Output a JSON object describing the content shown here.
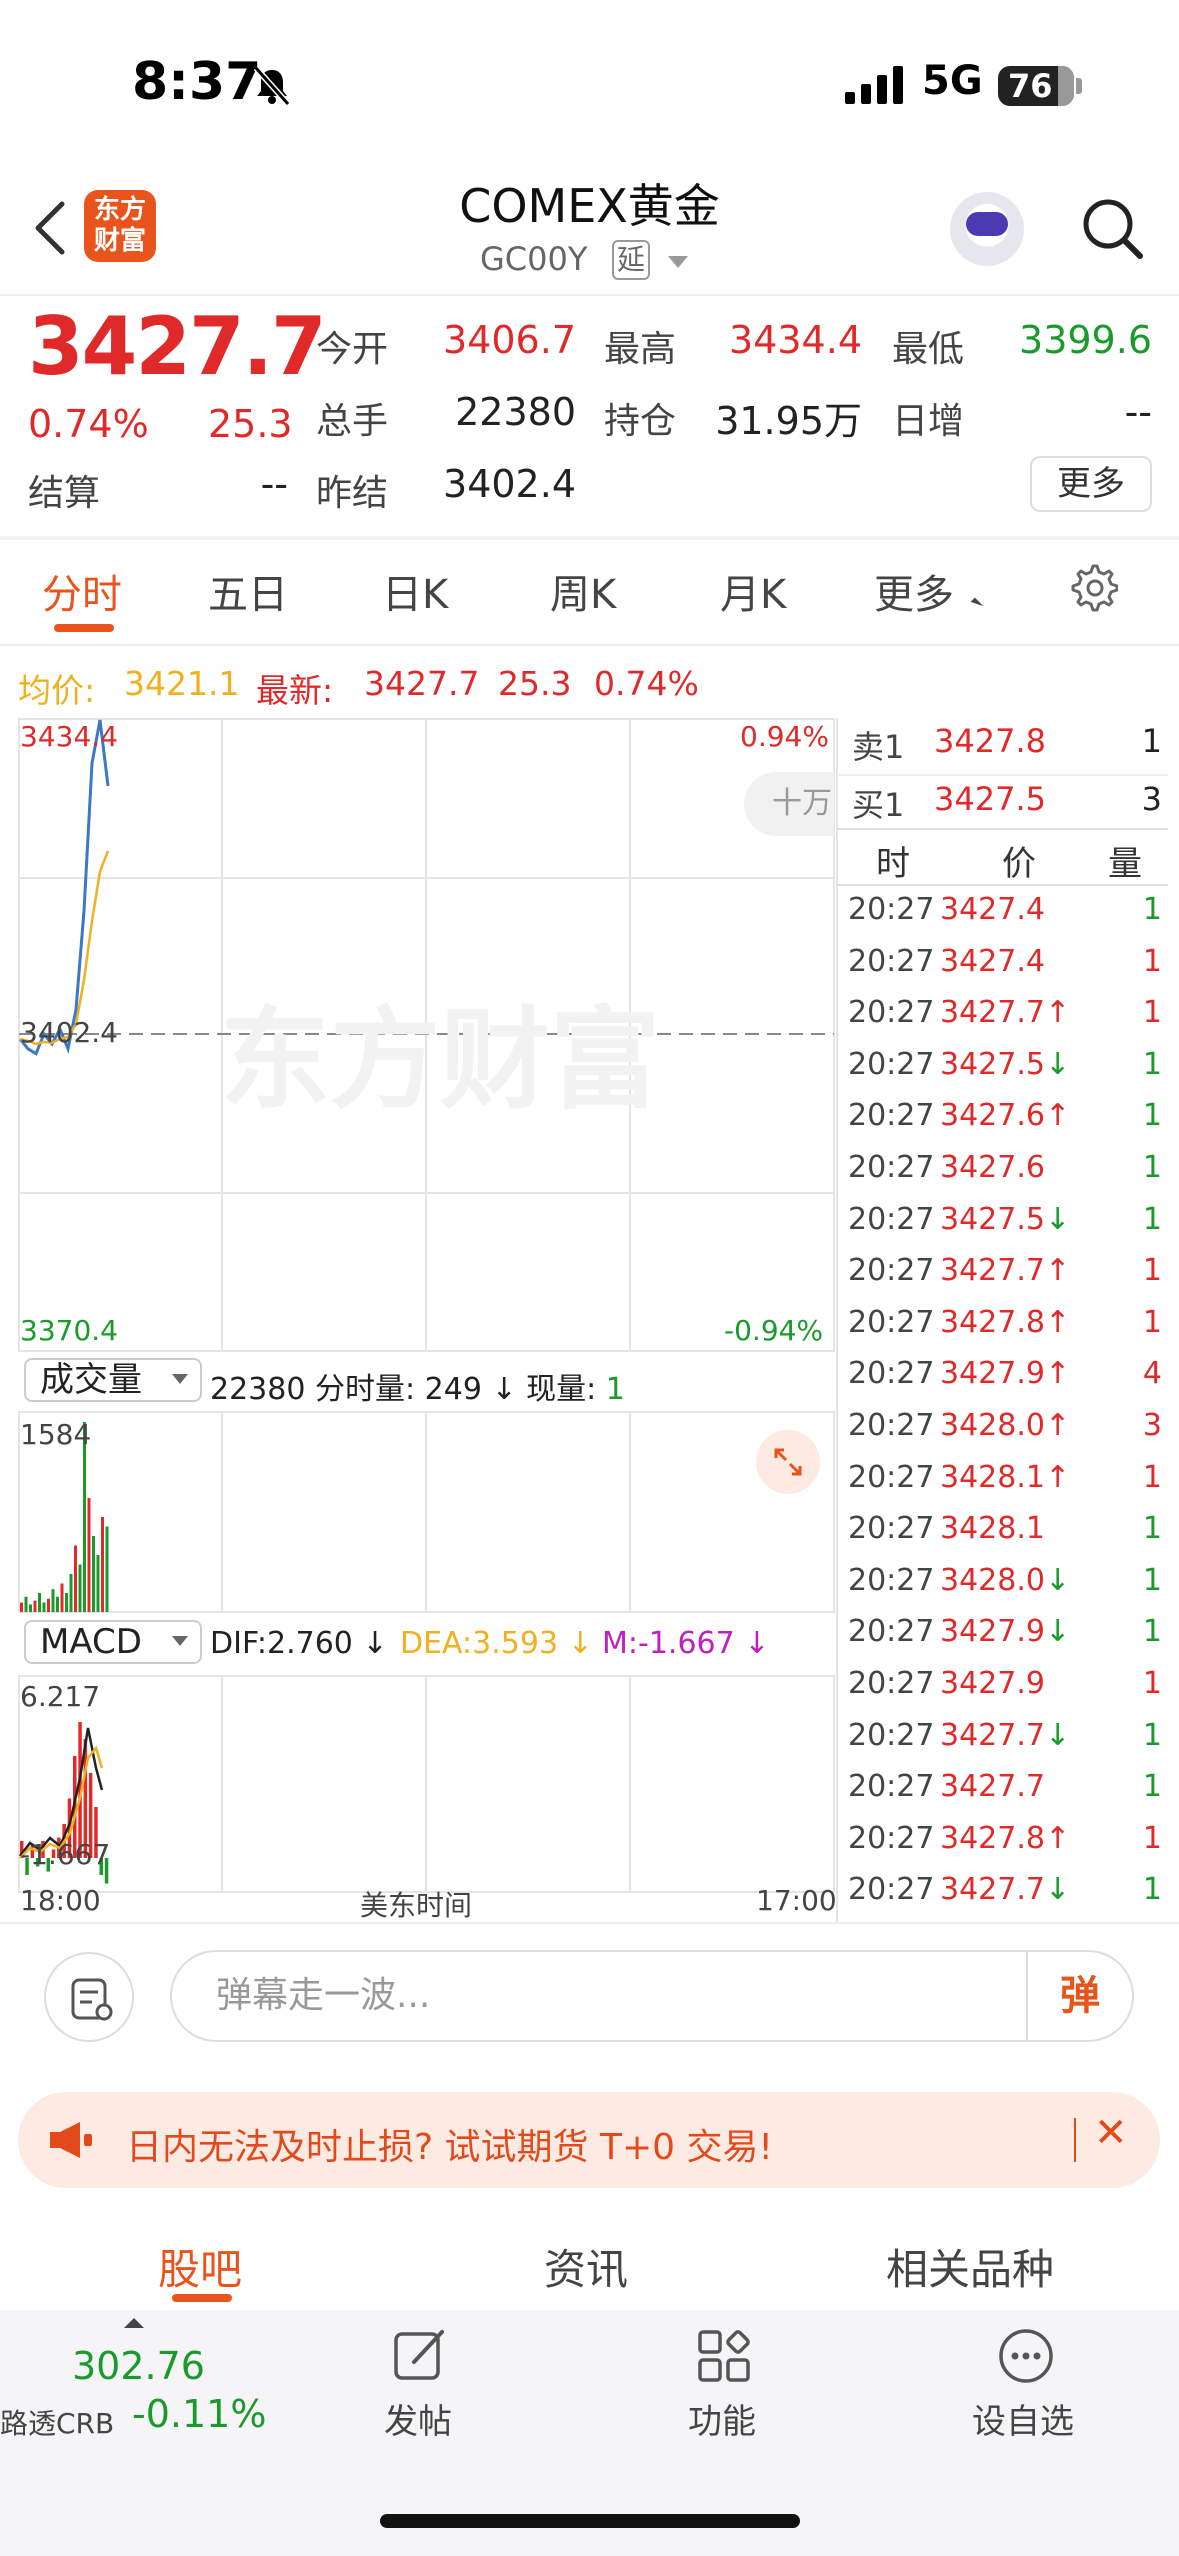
{
  "status": {
    "time": "8:37",
    "network": "5G",
    "battery": "76"
  },
  "header": {
    "logo_line1": "东方",
    "logo_line2": "财富",
    "title": "COMEX黄金",
    "code": "GC00Y",
    "tag": "延"
  },
  "quote": {
    "price": "3427.7",
    "pct": "0.74%",
    "change": "25.3",
    "open_label": "今开",
    "open": "3406.7",
    "high_label": "最高",
    "high": "3434.4",
    "low_label": "最低",
    "low": "3399.6",
    "volume_label": "总手",
    "volume": "22380",
    "oi_label": "持仓",
    "oi": "31.95万",
    "daily_inc_label": "日增",
    "daily_inc": "--",
    "settle_label": "结算",
    "settle": "--",
    "prev_settle_label": "昨结",
    "prev_settle": "3402.4",
    "more_label": "更多"
  },
  "tabs": [
    "分时",
    "五日",
    "日K",
    "周K",
    "月K",
    "更多"
  ],
  "info_line": {
    "avg_label": "均价:",
    "avg": "3421.1",
    "latest_label": "最新:",
    "latest": "3427.7",
    "change": "25.3",
    "pct": "0.74%"
  },
  "chart": {
    "y_top": "3434.4",
    "y_mid": "3402.4",
    "y_bottom": "3370.4",
    "pct_top": "0.94%",
    "pct_bottom": "-0.94%",
    "level2_tag": "十万",
    "watermark": "东方财富",
    "volume_select": "成交量",
    "volume_info_total": "22380",
    "volume_info_label": "分时量:",
    "volume_info_value": "249 ↓",
    "current_label": "现量:",
    "current_value": "1",
    "volume_max": "1584",
    "macd_select": "MACD",
    "dif": "DIF:2.760 ↓",
    "dea": "DEA:3.593 ↓",
    "m": "M:-1.667 ↓",
    "macd_top": "6.217",
    "macd_bottom": "-1.667",
    "x_start": "18:00",
    "x_mid": "美东时间",
    "x_end": "17:00"
  },
  "chart_data": {
    "type": "line",
    "x": [
      "18:00",
      "17:00"
    ],
    "series": [
      {
        "name": "最新",
        "values": [
          3402.0,
          3401.0,
          3400.5,
          3402.5,
          3401.5,
          3403.0,
          3401.0,
          3405.0,
          3415.0,
          3430.0,
          3434.4,
          3427.7
        ]
      },
      {
        "name": "均价",
        "values": [
          3402.0,
          3401.8,
          3401.5,
          3401.7,
          3401.6,
          3402.0,
          3402.2,
          3403.5,
          3408.0,
          3414.0,
          3419.0,
          3421.1
        ]
      }
    ],
    "ylim": [
      3370.4,
      3434.4
    ],
    "reference": 3402.4
  },
  "orderbook": {
    "sell_label": "卖1",
    "sell_price": "3427.8",
    "sell_qty": "1",
    "buy_label": "买1",
    "buy_price": "3427.5",
    "buy_qty": "3",
    "col_time": "时",
    "col_price": "价",
    "col_qty": "量"
  },
  "trades": [
    {
      "time": "20:27",
      "price": "3427.4",
      "dir": "",
      "qty": "1",
      "qcolor": "green"
    },
    {
      "time": "20:27",
      "price": "3427.4",
      "dir": "",
      "qty": "1",
      "qcolor": "red"
    },
    {
      "time": "20:27",
      "price": "3427.7",
      "dir": "↑",
      "qty": "1",
      "qcolor": "red"
    },
    {
      "time": "20:27",
      "price": "3427.5",
      "dir": "↓",
      "qty": "1",
      "qcolor": "green"
    },
    {
      "time": "20:27",
      "price": "3427.6",
      "dir": "↑",
      "qty": "1",
      "qcolor": "green"
    },
    {
      "time": "20:27",
      "price": "3427.6",
      "dir": "",
      "qty": "1",
      "qcolor": "green"
    },
    {
      "time": "20:27",
      "price": "3427.5",
      "dir": "↓",
      "qty": "1",
      "qcolor": "green"
    },
    {
      "time": "20:27",
      "price": "3427.7",
      "dir": "↑",
      "qty": "1",
      "qcolor": "red"
    },
    {
      "time": "20:27",
      "price": "3427.8",
      "dir": "↑",
      "qty": "1",
      "qcolor": "red"
    },
    {
      "time": "20:27",
      "price": "3427.9",
      "dir": "↑",
      "qty": "4",
      "qcolor": "red"
    },
    {
      "time": "20:27",
      "price": "3428.0",
      "dir": "↑",
      "qty": "3",
      "qcolor": "red"
    },
    {
      "time": "20:27",
      "price": "3428.1",
      "dir": "↑",
      "qty": "1",
      "qcolor": "red"
    },
    {
      "time": "20:27",
      "price": "3428.1",
      "dir": "",
      "qty": "1",
      "qcolor": "green"
    },
    {
      "time": "20:27",
      "price": "3428.0",
      "dir": "↓",
      "qty": "1",
      "qcolor": "green"
    },
    {
      "time": "20:27",
      "price": "3427.9",
      "dir": "↓",
      "qty": "1",
      "qcolor": "green"
    },
    {
      "time": "20:27",
      "price": "3427.9",
      "dir": "",
      "qty": "1",
      "qcolor": "red"
    },
    {
      "time": "20:27",
      "price": "3427.7",
      "dir": "↓",
      "qty": "1",
      "qcolor": "green"
    },
    {
      "time": "20:27",
      "price": "3427.7",
      "dir": "",
      "qty": "1",
      "qcolor": "green"
    },
    {
      "time": "20:27",
      "price": "3427.8",
      "dir": "↑",
      "qty": "1",
      "qcolor": "red"
    },
    {
      "time": "20:27",
      "price": "3427.7",
      "dir": "↓",
      "qty": "1",
      "qcolor": "green"
    }
  ],
  "comment": {
    "placeholder": "弹幕走一波...",
    "danmu_label": "弹"
  },
  "banner": {
    "text": "日内无法及时止损? 试试期货 T+0 交易!"
  },
  "bottom_tabs": [
    "股吧",
    "资讯",
    "相关品种"
  ],
  "bottom_nav": {
    "index_value": "302.76",
    "index_name": "路透CRB",
    "index_pct": "-0.11%",
    "post_label": "发帖",
    "func_label": "功能",
    "watch_label": "设自选"
  },
  "colors": {
    "accent": "#e8541c",
    "up": "#e02a2a",
    "down": "#1a9a2a",
    "price_line": "#3a78c8",
    "avg_line": "#f0b020"
  }
}
